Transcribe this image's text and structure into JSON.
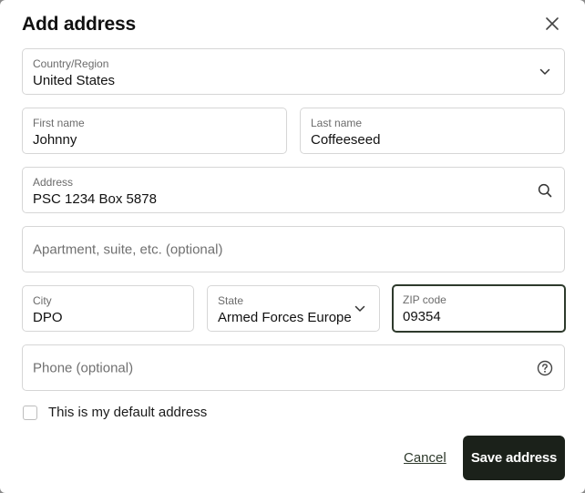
{
  "dialog": {
    "title": "Add address"
  },
  "form": {
    "country": {
      "label": "Country/Region",
      "value": "United States"
    },
    "first_name": {
      "label": "First name",
      "value": "Johnny"
    },
    "last_name": {
      "label": "Last name",
      "value": "Coffeeseed"
    },
    "address": {
      "label": "Address",
      "value": "PSC 1234 Box 5878"
    },
    "apartment": {
      "placeholder": "Apartment, suite, etc. (optional)"
    },
    "city": {
      "label": "City",
      "value": "DPO"
    },
    "state": {
      "label": "State",
      "value": "Armed Forces Europe"
    },
    "zip": {
      "label": "ZIP code",
      "value": "09354"
    },
    "phone": {
      "placeholder": "Phone (optional)"
    },
    "default_checkbox": {
      "label": "This is my default address",
      "checked": false
    }
  },
  "actions": {
    "cancel_label": "Cancel",
    "save_label": "Save address"
  },
  "icons": {
    "close": "close-icon",
    "chevron": "chevron-down-icon",
    "search": "search-icon",
    "help": "help-circle-icon"
  },
  "colors": {
    "primary_button": "#1b211a",
    "focus_border": "#2e3a2c",
    "field_border": "#d6d6d6"
  }
}
